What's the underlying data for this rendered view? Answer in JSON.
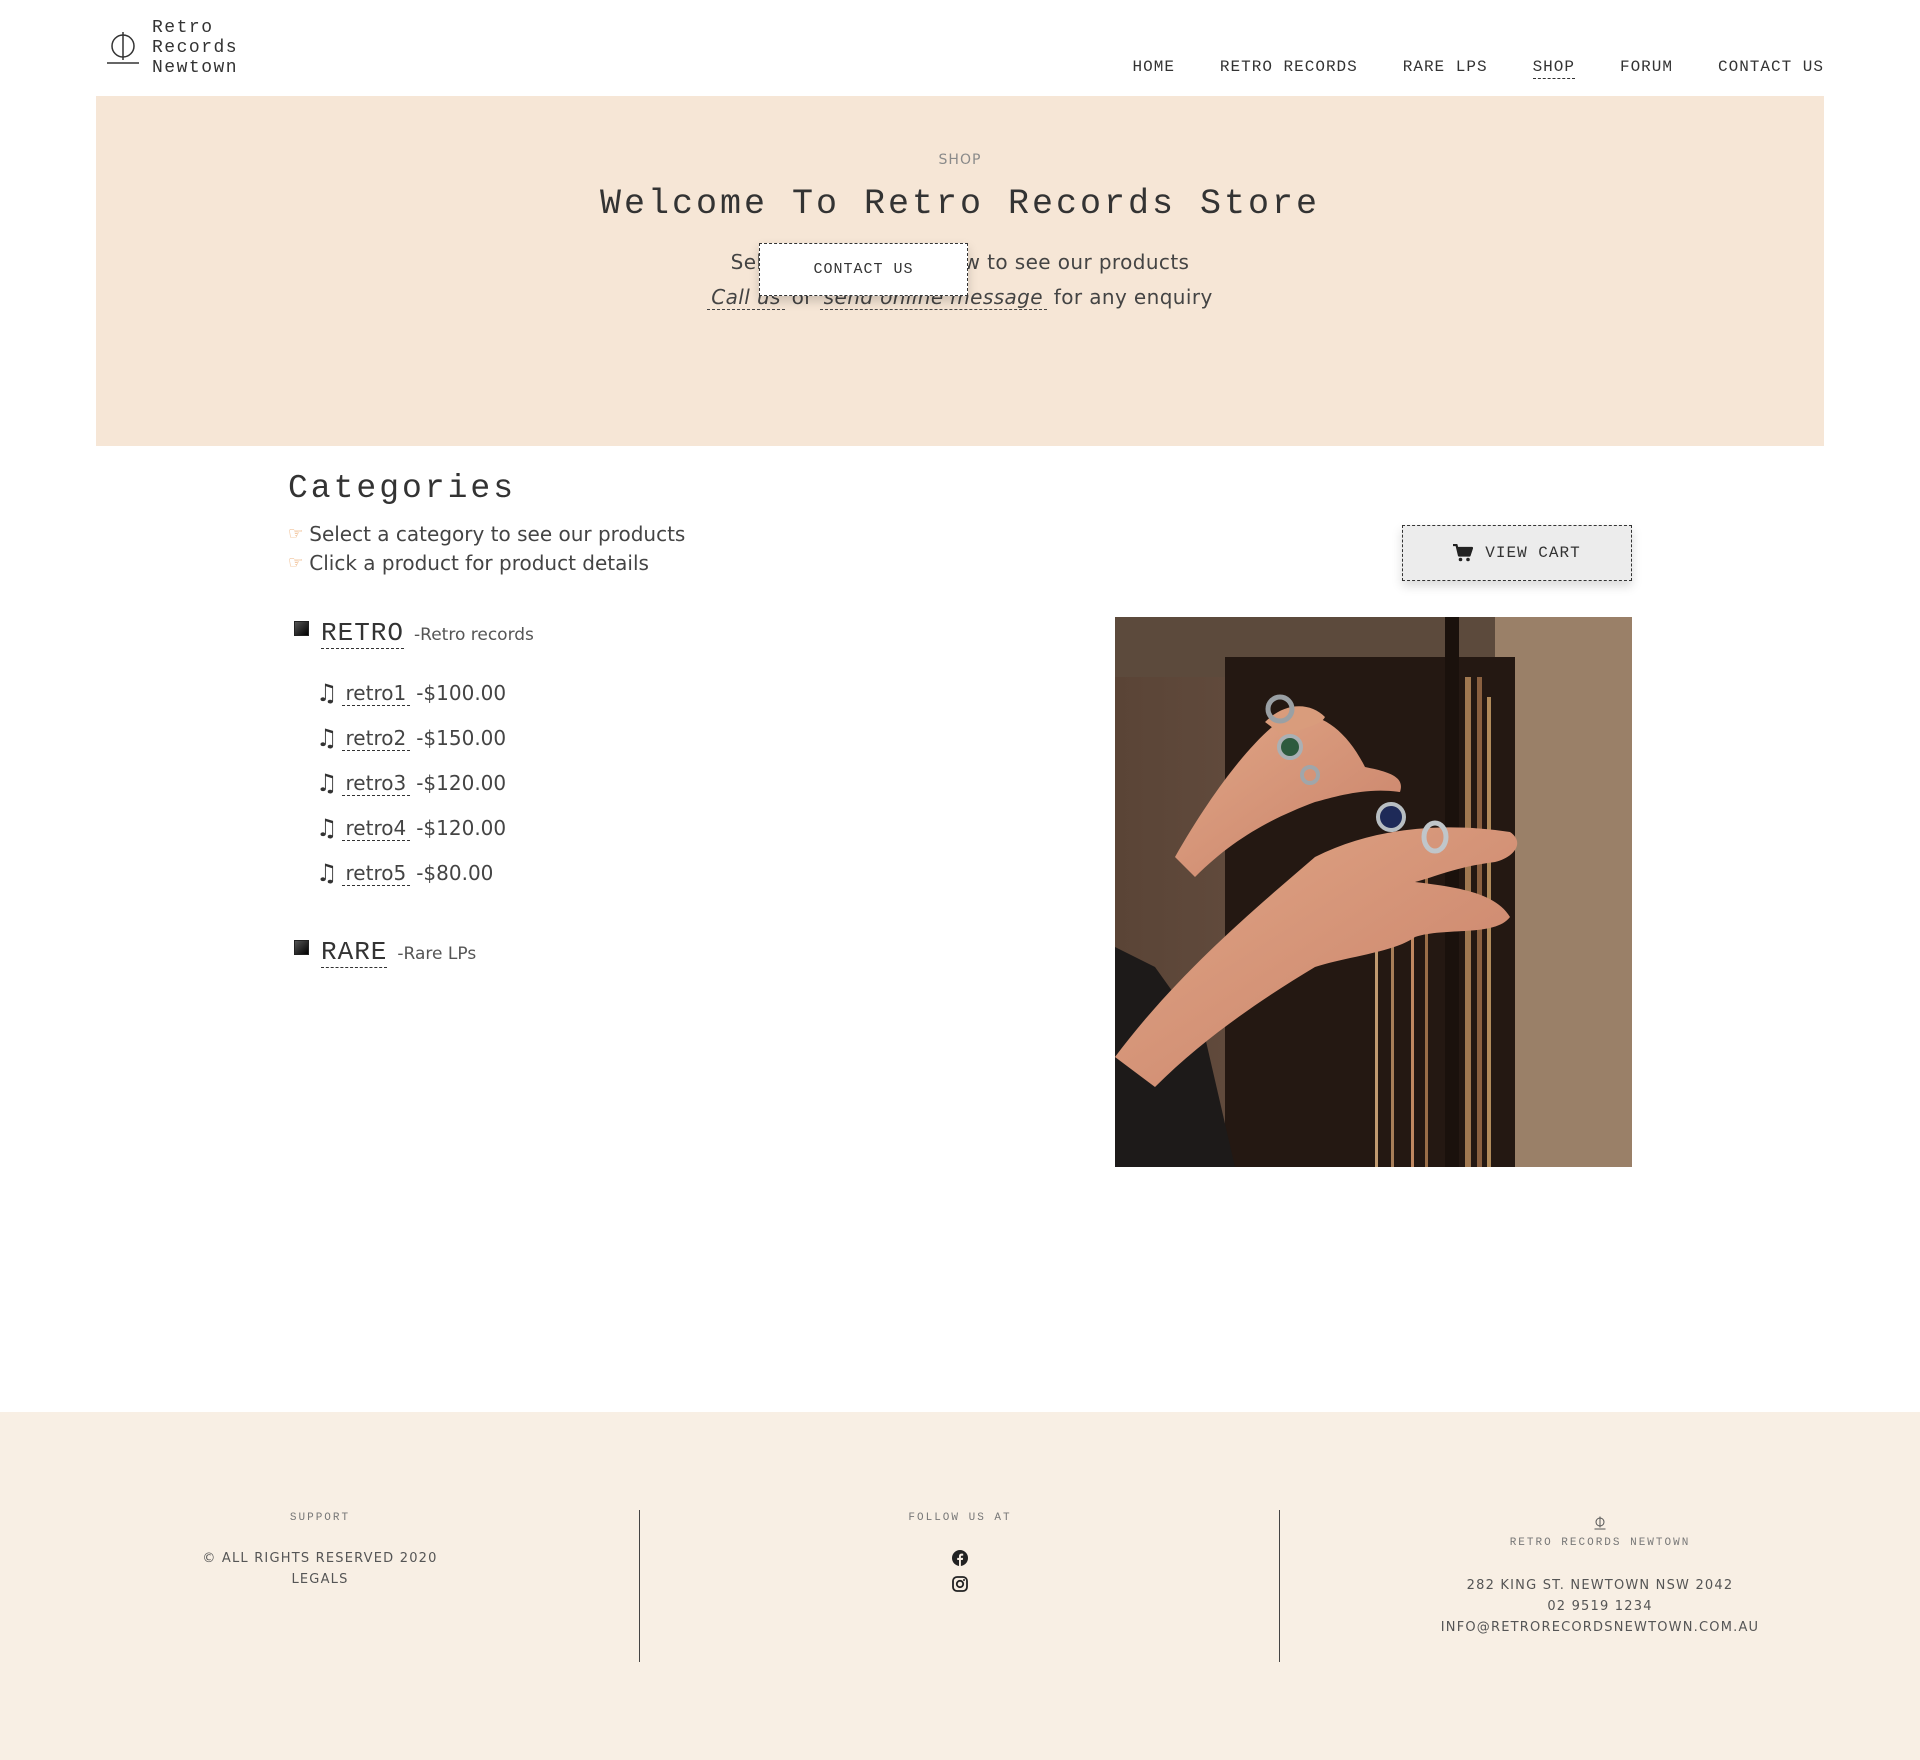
{
  "brand": {
    "name": "Retro\nRecords\nNewtown"
  },
  "nav": {
    "items": [
      {
        "label": "HOME"
      },
      {
        "label": "RETRO RECORDS"
      },
      {
        "label": "RARE LPS"
      },
      {
        "label": "SHOP",
        "active": true
      },
      {
        "label": "FORUM"
      },
      {
        "label": "CONTACT US"
      }
    ]
  },
  "hero": {
    "eyebrow": "SHOP",
    "title": "Welcome To Retro Records Store",
    "line1": "Select a category below to see our products",
    "call_link": "Call us",
    "or_text": "or",
    "message_link": "send online message",
    "enquiry_text": "for any enquiry",
    "button": "CONTACT US"
  },
  "categories": {
    "title": "Categories",
    "hint1": "Select a category to see our products",
    "hint2": "Click a product for product details",
    "view_cart": "VIEW CART",
    "list": [
      {
        "name": "RETRO",
        "desc": "-Retro records",
        "products": [
          {
            "name": "retro1",
            "price": "-$100.00"
          },
          {
            "name": "retro2",
            "price": "-$150.00"
          },
          {
            "name": "retro3",
            "price": "-$120.00"
          },
          {
            "name": "retro4",
            "price": "-$120.00"
          },
          {
            "name": "retro5",
            "price": "-$80.00"
          }
        ]
      },
      {
        "name": "RARE",
        "desc": "-Rare LPs"
      }
    ]
  },
  "footer": {
    "support": {
      "label": "SUPPORT",
      "rights": "© ALL RIGHTS RESERVED 2020",
      "legals": "LEGALS"
    },
    "follow": {
      "label": "FOLLOW US AT"
    },
    "contact": {
      "label": "RETRO RECORDS NEWTOWN",
      "address": "282 KING ST. NEWTOWN NSW 2042",
      "phone": "02 9519 1234",
      "email": "INFO@RETRORECORDSNEWTOWN.COM.AU"
    }
  },
  "colors": {
    "hero_bg": "#f6e6d6",
    "footer_bg": "#f8efe4",
    "text": "#333333"
  },
  "icons": {
    "logo": "globe-line-icon",
    "cart": "cart-icon",
    "hand": "pointing-hand-icon",
    "note": "music-note-icon",
    "facebook": "facebook-icon",
    "instagram": "instagram-icon"
  }
}
